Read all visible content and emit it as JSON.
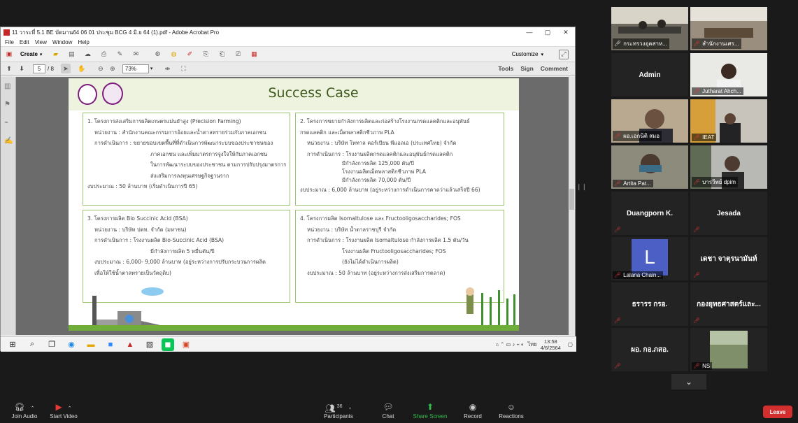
{
  "acrobat": {
    "title": "11 วาระที่ 5.1 BE บัดมาน64 06 01 ประชุม BCG 4 มิ.ย 64 (1).pdf - Adobe Acrobat Pro",
    "menu": [
      "File",
      "Edit",
      "View",
      "Window",
      "Help"
    ],
    "create_label": "Create",
    "customize_label": "Customize",
    "page_current": "5",
    "page_total": "/ 8",
    "zoom": "73%",
    "links": [
      "Tools",
      "Sign",
      "Comment"
    ]
  },
  "slide": {
    "title": "Success Case",
    "cards": [
      {
        "lines": [
          "1. โครงการส่งเสริมการผลิตเกษตรแม่นยำสูง (Precision Farming)",
          "หน่วยงาน : สำนักงานคณะกรรมการอ้อยและน้ำตาลทรายร่วมกับภาคเอกชน",
          "การดำเนินการ : ขยายขอบเขตพื้นที่ที่ดำเนินการพัฒนาระบบของประชาชนของ",
          "ภาคเอกชน และเพิ่มมาตรการจูงใจให้กับภาคเอกชน",
          "ในการพัฒนาระบบของประชาชน ตามการปรับปรุงมาตรการ",
          "ส่งเสริมการลงทุนเศรษฐกิจฐานราก",
          "งบประมาณ : 50 ล้านบาท (เริ่มดำเนินการปี 65)"
        ]
      },
      {
        "lines": [
          "2. โครงการขยายกำลังการผลิตและก่อสร้างโรงงานกรดแลคติกและอนุพันธ์",
          "กรดแลคติก และเม็ดพลาสติกชีวภาพ PLA",
          "หน่วยงาน : บริษัท โททาล คอร์เบียน พีแอลเอ (ประเทศไทย) จำกัด",
          "การดำเนินการ : โรงงานผลิตกรดแลคติกและอนุพันธ์กรดแลคติก",
          "มีกำลังการผลิต 125,000 ตัน/ปี",
          "โรงงานผลิตเม็ดพลาสติกชีวภาพ PLA",
          "มีกำลังการผลิต 70,000 ตัน/ปี",
          "งบประมาณ : 6,000 ล้านบาท (อยู่ระหว่างการดำเนินการคาดว่าแล้วเสร็จปี 66)"
        ]
      },
      {
        "lines": [
          "3. โครงการผลิต Bio Succinic Acid (BSA)",
          "หน่วยงาน : บริษัท ปตท. จำกัด (มหาชน)",
          "การดำเนินการ : โรงงานผลิต Bio-Succinic Acid (BSA)",
          "มีกำลังการผลิต 5 หมื่นตัน/ปี",
          "งบประมาณ : 6,000- 9,000 ล้านบาท (อยู่ระหว่างการปรับกระบวนการผลิต",
          "เพื่อให้ใช้น้ำตาลทรายเป็นวัตถุดิบ)"
        ]
      },
      {
        "lines": [
          "4. โครงการผลิต Isomaltulose และ Fructooligosaccharides; FOS",
          "หน่วยงาน : บริษัท น้ำตาลราชบุรี จำกัด",
          "การดำเนินการ : โรงงานผลิต Isomaltulose กำลังการผลิต 1.5 ตัน/วัน",
          "โรงงานผลิต Fructooligosaccharides; FOS",
          "(ยังไม่ได้ดำเนินการผลิต)",
          "งบประมาณ : 50 ล้านบาท (อยู่ระหว่างการส่งเสริมการตลาด)"
        ]
      }
    ]
  },
  "taskbar": {
    "language": "ไทย",
    "time": "13:58",
    "date": "4/6/2564"
  },
  "participants": [
    {
      "name": "กระทรวงอุตสาห...",
      "type": "video"
    },
    {
      "name": "สำนักงานเศร...",
      "type": "video"
    },
    {
      "name": "Admin",
      "type": "name"
    },
    {
      "name": "Jutharat Ahch...",
      "type": "video"
    },
    {
      "name": "ผอ.เอกนิติ สมอ",
      "type": "video"
    },
    {
      "name": "IEAT",
      "type": "video"
    },
    {
      "name": "Artita Pat...",
      "type": "video"
    },
    {
      "name": "บารวีพย์ dpim",
      "type": "video"
    },
    {
      "name": "Duangporn K.",
      "type": "name"
    },
    {
      "name": "Jesada",
      "type": "name"
    },
    {
      "name": "Lalana Chain...",
      "type": "avatar",
      "initial": "L"
    },
    {
      "name": "เดชา จาตุรนามันท์",
      "type": "name"
    },
    {
      "name": "ธรารร กรอ.",
      "type": "name"
    },
    {
      "name": "กองยุทธศาสตร์และ...",
      "type": "name"
    },
    {
      "name": "ผอ. กอ.ภสอ.",
      "type": "name"
    },
    {
      "name": "NS",
      "type": "video"
    }
  ],
  "zoom_bar": {
    "join_audio": "Join Audio",
    "start_video": "Start Video",
    "participants": "Participants",
    "participants_count": "36",
    "chat": "Chat",
    "share_screen": "Share Screen",
    "record": "Record",
    "reactions": "Reactions",
    "leave": "Leave"
  },
  "colors": {
    "accent_green": "#2fbf4a",
    "leave_red": "#d32f2f",
    "active_speaker": "#d5dd2a",
    "slide_title": "#3d5a1a"
  }
}
